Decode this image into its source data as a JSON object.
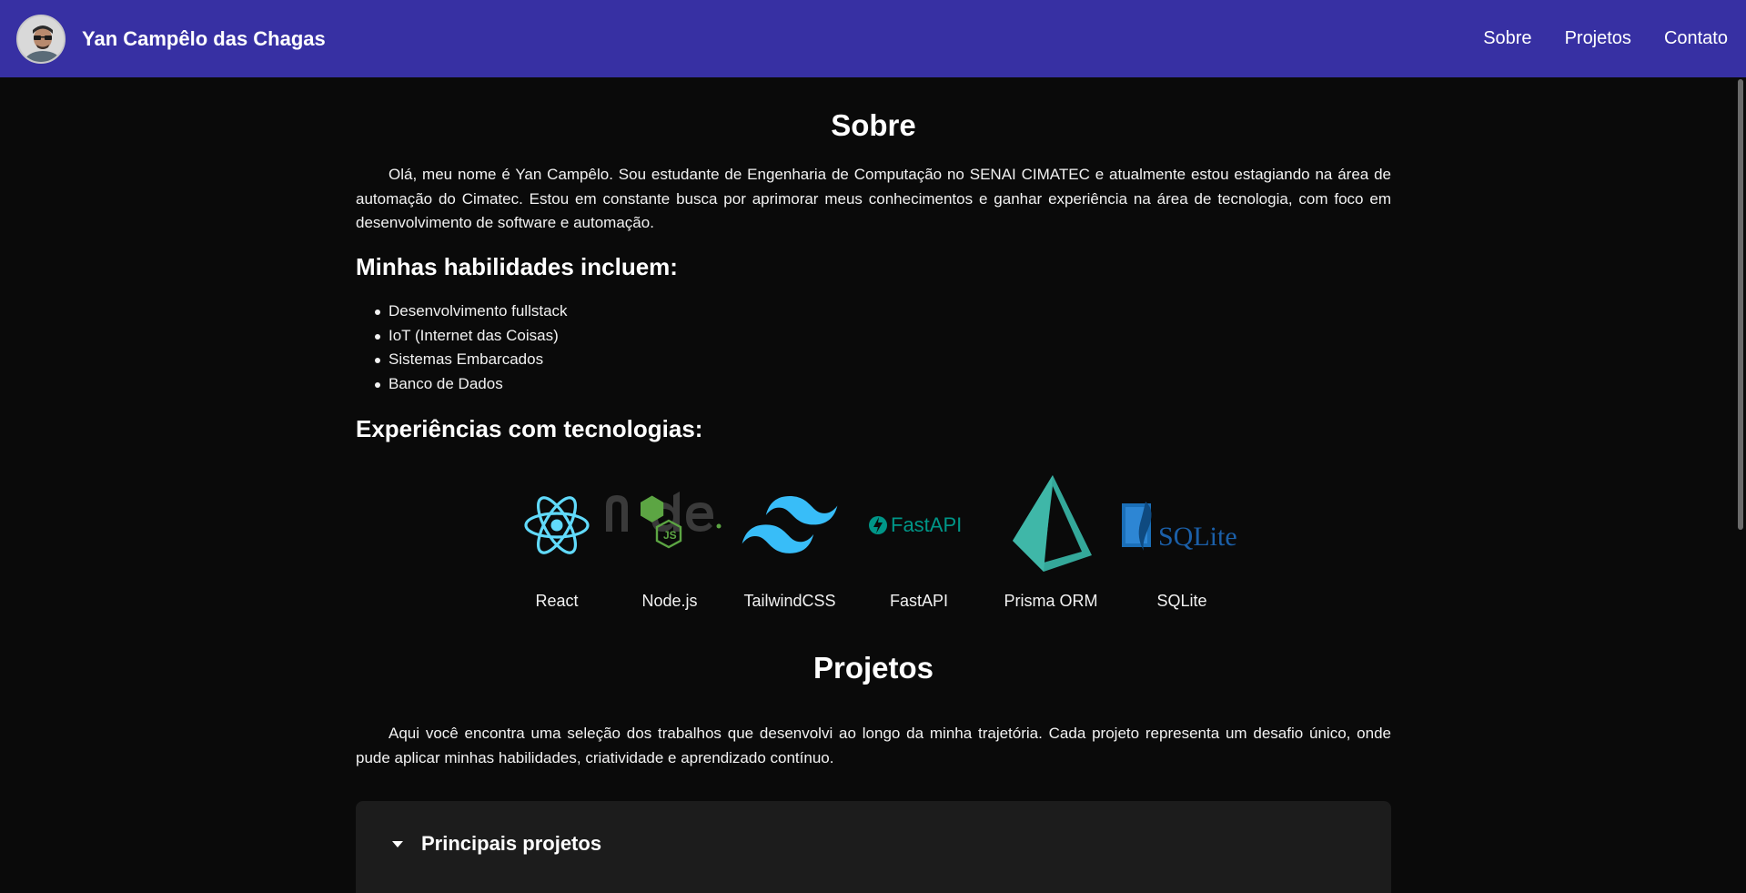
{
  "header": {
    "name": "Yan Campêlo das Chagas",
    "nav": [
      "Sobre",
      "Projetos",
      "Contato"
    ]
  },
  "about": {
    "title": "Sobre",
    "intro": "Olá, meu nome é Yan Campêlo. Sou estudante de Engenharia de Computação no SENAI CIMATEC e atualmente estou estagiando na área de automação do Cimatec. Estou em constante busca por aprimorar meus conhecimentos e ganhar experiência na área de tecnologia, com foco em desenvolvimento de software e automação.",
    "skills_title": "Minhas habilidades incluem:",
    "skills": [
      "Desenvolvimento fullstack",
      "IoT (Internet das Coisas)",
      "Sistemas Embarcados",
      "Banco de Dados"
    ],
    "tech_title": "Experiências com tecnologias:",
    "technologies": [
      {
        "label": "React",
        "icon": "react-icon"
      },
      {
        "label": "Node.js",
        "icon": "nodejs-icon"
      },
      {
        "label": "TailwindCSS",
        "icon": "tailwind-icon"
      },
      {
        "label": "FastAPI",
        "icon": "fastapi-icon",
        "logo_text": "FastAPI"
      },
      {
        "label": "Prisma ORM",
        "icon": "prisma-icon"
      },
      {
        "label": "SQLite",
        "icon": "sqlite-icon",
        "logo_text": "SQLite"
      }
    ]
  },
  "projects": {
    "title": "Projetos",
    "intro": "Aqui você encontra uma seleção dos trabalhos que desenvolvi ao longo da minha trajetória. Cada projeto representa um desafio único, onde pude aplicar minhas habilidades, criatividade e aprendizado contínuo.",
    "accordion_title": "Principais projetos"
  },
  "colors": {
    "header_bg": "#3730a3",
    "page_bg": "#0a0a0a",
    "card_bg": "#1c1c1c"
  }
}
